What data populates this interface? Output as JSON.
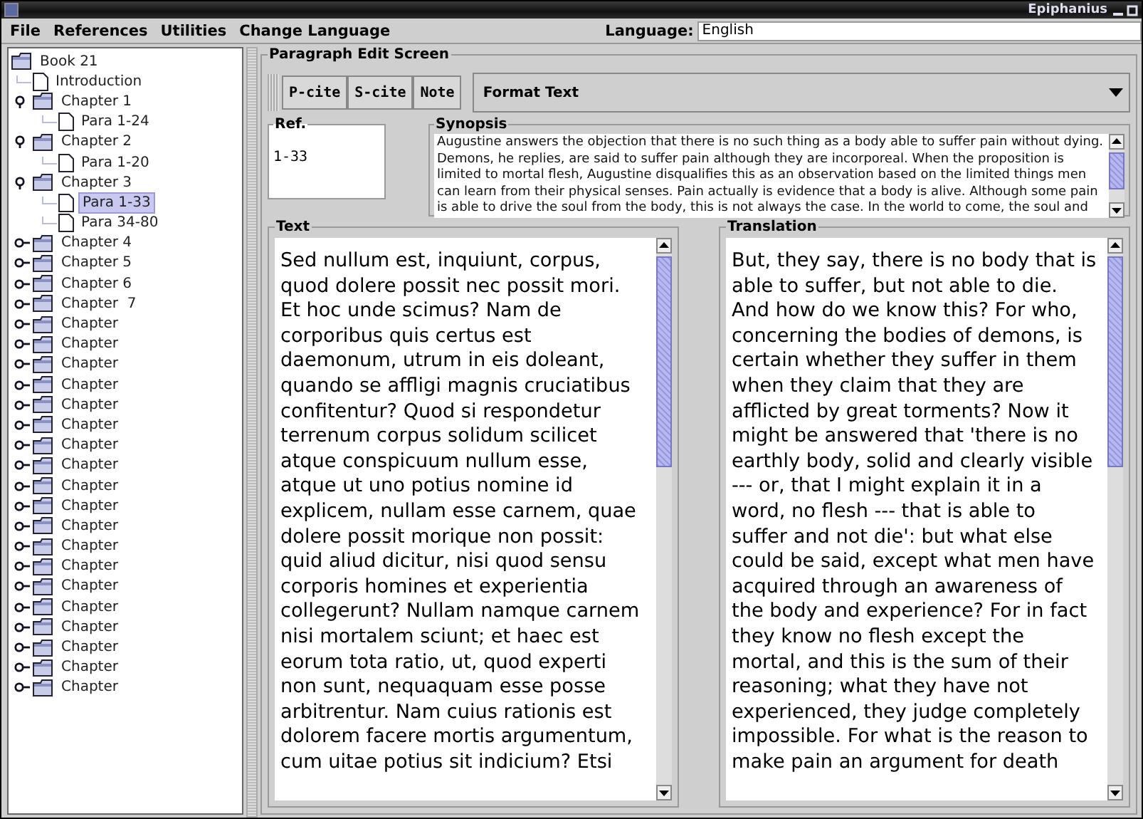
{
  "window": {
    "title": "Epiphanius"
  },
  "menu": [
    "File",
    "References",
    "Utilities",
    "Change Language"
  ],
  "language": {
    "label": "Language:",
    "value": "English"
  },
  "tree": {
    "label": "Book 21",
    "kind": "folder",
    "selected": false,
    "children": [
      {
        "label": "Introduction",
        "kind": "page",
        "selected": false
      },
      {
        "label": "Chapter 1",
        "kind": "folder",
        "expanded": true,
        "selected": false,
        "children": [
          {
            "label": "Para 1-24",
            "kind": "page",
            "selected": false
          }
        ]
      },
      {
        "label": "Chapter 2",
        "kind": "folder",
        "expanded": true,
        "selected": false,
        "children": [
          {
            "label": "Para 1-20",
            "kind": "page",
            "selected": false
          }
        ]
      },
      {
        "label": "Chapter 3",
        "kind": "folder",
        "expanded": true,
        "selected": false,
        "children": [
          {
            "label": "Para 1-33",
            "kind": "page",
            "selected": true
          },
          {
            "label": "Para 34-80",
            "kind": "page",
            "selected": false
          }
        ]
      },
      {
        "label": "Chapter 4",
        "kind": "folder",
        "expanded": false,
        "selected": false
      },
      {
        "label": "Chapter 5",
        "kind": "folder",
        "expanded": false,
        "selected": false
      },
      {
        "label": "Chapter 6",
        "kind": "folder",
        "expanded": false,
        "selected": false
      },
      {
        "label": "Chapter  7",
        "kind": "folder",
        "expanded": false,
        "selected": false
      },
      {
        "label": "Chapter",
        "kind": "folder",
        "expanded": false,
        "selected": false
      },
      {
        "label": "Chapter",
        "kind": "folder",
        "expanded": false,
        "selected": false
      },
      {
        "label": "Chapter",
        "kind": "folder",
        "expanded": false,
        "selected": false
      },
      {
        "label": "Chapter",
        "kind": "folder",
        "expanded": false,
        "selected": false
      },
      {
        "label": "Chapter",
        "kind": "folder",
        "expanded": false,
        "selected": false
      },
      {
        "label": "Chapter",
        "kind": "folder",
        "expanded": false,
        "selected": false
      },
      {
        "label": "Chapter",
        "kind": "folder",
        "expanded": false,
        "selected": false
      },
      {
        "label": "Chapter",
        "kind": "folder",
        "expanded": false,
        "selected": false
      },
      {
        "label": "Chapter",
        "kind": "folder",
        "expanded": false,
        "selected": false
      },
      {
        "label": "Chapter",
        "kind": "folder",
        "expanded": false,
        "selected": false
      },
      {
        "label": "Chapter",
        "kind": "folder",
        "expanded": false,
        "selected": false
      },
      {
        "label": "Chapter",
        "kind": "folder",
        "expanded": false,
        "selected": false
      },
      {
        "label": "Chapter",
        "kind": "folder",
        "expanded": false,
        "selected": false
      },
      {
        "label": "Chapter",
        "kind": "folder",
        "expanded": false,
        "selected": false
      },
      {
        "label": "Chapter",
        "kind": "folder",
        "expanded": false,
        "selected": false
      },
      {
        "label": "Chapter",
        "kind": "folder",
        "expanded": false,
        "selected": false
      },
      {
        "label": "Chapter",
        "kind": "folder",
        "expanded": false,
        "selected": false
      },
      {
        "label": "Chapter",
        "kind": "folder",
        "expanded": false,
        "selected": false
      },
      {
        "label": "Chapter",
        "kind": "folder",
        "expanded": false,
        "selected": false
      }
    ]
  },
  "edit_panel": {
    "title": "Paragraph Edit Screen",
    "buttons": [
      "P-cite",
      "S-cite",
      "Note"
    ],
    "format_combo": "Format Text",
    "ref": {
      "title": "Ref.",
      "value": "1-33"
    },
    "synopsis": {
      "title": "Synopsis",
      "text": "Augustine answers the objection that there is no such thing as a body able to suffer pain without dying.\nDemons, he replies, are said to suffer pain although they are incorporeal. When the proposition is\nlimited to mortal flesh, Augustine disqualifies this as an observation based on the limited things men\ncan learn from their physical senses. Pain actually is evidence that a body is alive. Although some pain\nis able to drive the soul from the body, this is not always the case. In the world to come, the soul and"
    },
    "text": {
      "title": "Text",
      "value": "Sed nullum est, inquiunt, corpus,\nquod dolere possit nec possit mori.\nEt hoc unde scimus? Nam de\ncorporibus quis certus est\ndaemonum, utrum in eis doleant,\nquando se affligi magnis cruciatibus\nconfitentur? Quod si respondetur\nterrenum corpus solidum scilicet\natque conspicuum nullum esse,\natque ut uno potius nomine id\nexplicem, nullam esse carnem, quae\ndolere possit morique non possit:\nquid aliud dicitur, nisi quod sensu\ncorporis homines et experientia\ncollegerunt? Nullam namque carnem\nnisi mortalem sciunt; et haec est\neorum tota ratio, ut, quod experti\nnon sunt, nequaquam esse posse\narbitrentur. Nam cuius rationis est\ndolorem facere mortis argumentum,\ncum uitae potius sit indicium? Etsi"
    },
    "translation": {
      "title": "Translation",
      "value": "But, they say, there is no body that is\nable to suffer, but not able to die.\nAnd how do we know this? For who,\nconcerning the bodies of demons, is\ncertain whether they suffer in them\nwhen they claim that they are\nafflicted by great torments? Now it\nmight be answered that 'there is no\nearthly body, solid and clearly visible\n--- or, that I might explain it in a\nword, no flesh --- that is able to\nsuffer and not die': but what else\ncould be said, except what men have\nacquired through an awareness of\nthe body and experience? For in fact\nthey know no flesh except the\nmortal, and this is the sum of their\nreasoning; what they have not\nexperienced, they judge completely\nimpossible. For what is the reason to\nmake pain an argument for death"
    }
  }
}
